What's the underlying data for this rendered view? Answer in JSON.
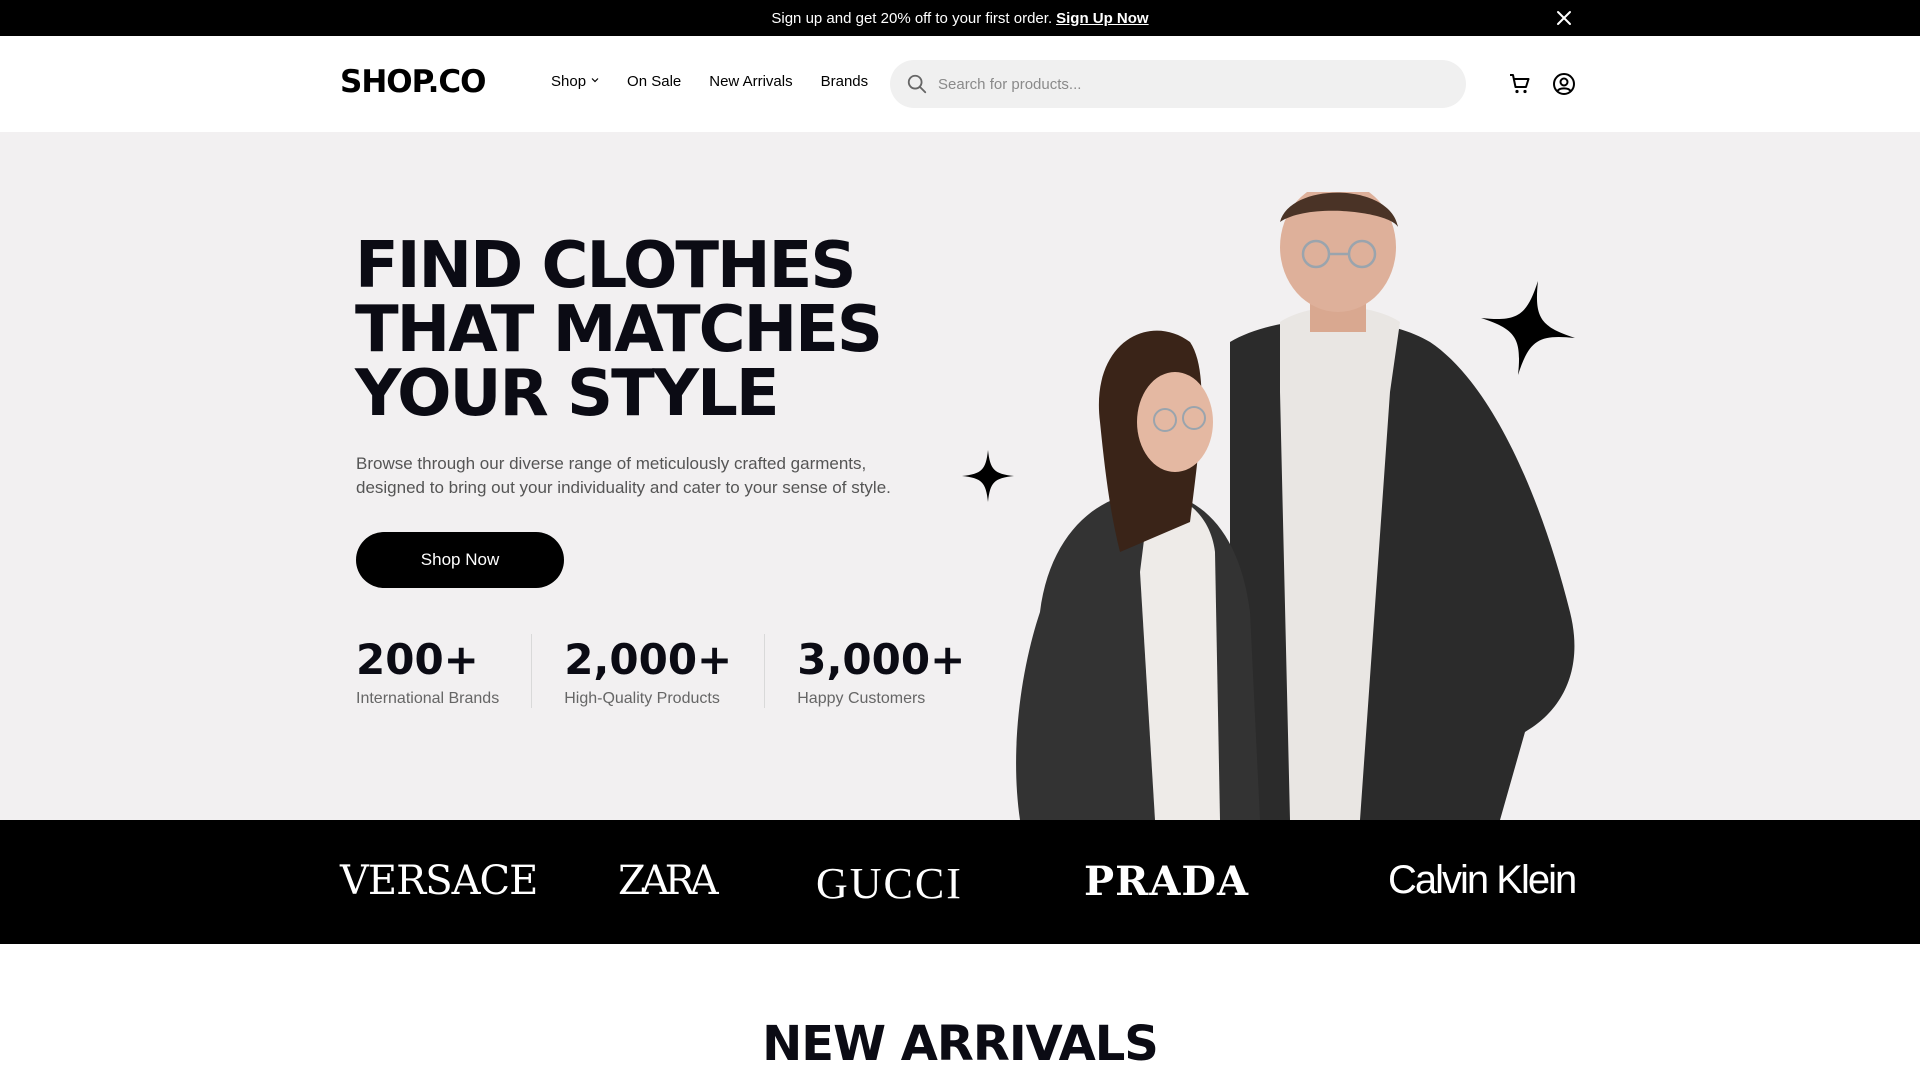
{
  "promo": {
    "text": "Sign up and get 20% off to your first order.",
    "link": "Sign Up Now"
  },
  "header": {
    "logo": "SHOP.CO",
    "nav": [
      "Shop",
      "On Sale",
      "New Arrivals",
      "Brands"
    ],
    "search_placeholder": "Search for products..."
  },
  "hero": {
    "headline": "FIND CLOTHES\nTHAT MATCHES\nYOUR STYLE",
    "subtitle": "Browse through our diverse range of meticulously crafted garments, designed to bring out your individuality and cater to your sense of style.",
    "cta": "Shop Now",
    "stats": [
      {
        "value": "200+",
        "label": "International Brands"
      },
      {
        "value": "2,000+",
        "label": "High-Quality Products"
      },
      {
        "value": "3,000+",
        "label": "Happy Customers"
      }
    ]
  },
  "brands": [
    "VERSACE",
    "ZARA",
    "GUCCI",
    "PRADA",
    "Calvin Klein"
  ],
  "section": {
    "title": "NEW ARRIVALS"
  },
  "colors": {
    "hero_bg": "#f2f0f1",
    "dark": "#000000",
    "muted_text": "#555555"
  }
}
